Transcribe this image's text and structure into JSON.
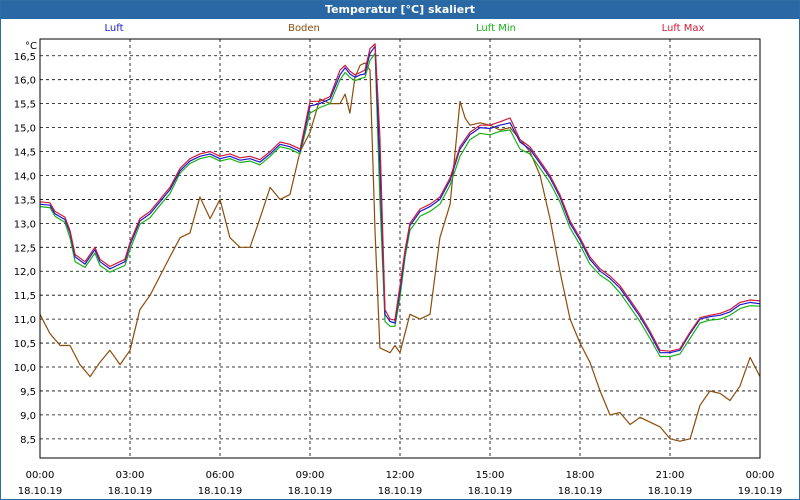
{
  "window": {
    "title": "Temperatur [°C] skaliert"
  },
  "chart_data": {
    "type": "line",
    "title": "Temperatur [°C] skaliert",
    "ylabel": "°C",
    "xlabel": "",
    "ylim": [
      8.1,
      16.85
    ],
    "xlim": [
      0,
      24
    ],
    "grid": true,
    "legend_placement": "top",
    "y_ticks": [
      "8,5",
      "9,0",
      "9,5",
      "10,0",
      "10,5",
      "11,0",
      "11,5",
      "12,0",
      "12,5",
      "13,0",
      "13,5",
      "14,0",
      "14,5",
      "15,0",
      "15,5",
      "16,0",
      "16,5"
    ],
    "x_ticks": [
      {
        "time": "00:00",
        "date": "18.10.19"
      },
      {
        "time": "03:00",
        "date": "18.10.19"
      },
      {
        "time": "06:00",
        "date": "18.10.19"
      },
      {
        "time": "09:00",
        "date": "18.10.19"
      },
      {
        "time": "12:00",
        "date": "18.10.19"
      },
      {
        "time": "15:00",
        "date": "18.10.19"
      },
      {
        "time": "18:00",
        "date": "18.10.19"
      },
      {
        "time": "21:00",
        "date": "18.10.19"
      },
      {
        "time": "00:00",
        "date": "19.10.19"
      }
    ],
    "series": [
      {
        "name": "Luft",
        "color": "#1a1ad0",
        "x": [
          0,
          0.33,
          0.5,
          0.83,
          1.0,
          1.17,
          1.5,
          1.83,
          2.0,
          2.33,
          2.5,
          2.83,
          3.0,
          3.33,
          3.67,
          4.0,
          4.33,
          4.67,
          5.0,
          5.33,
          5.67,
          6.0,
          6.33,
          6.67,
          7.0,
          7.33,
          7.67,
          8.0,
          8.33,
          8.67,
          9.0,
          9.33,
          9.67,
          10.0,
          10.17,
          10.33,
          10.5,
          10.67,
          10.83,
          11.0,
          11.17,
          11.33,
          11.5,
          11.67,
          11.83,
          12.0,
          12.17,
          12.33,
          12.67,
          13.0,
          13.33,
          13.67,
          14.0,
          14.33,
          14.67,
          15.0,
          15.33,
          15.67,
          16.0,
          16.33,
          16.67,
          17.0,
          17.33,
          17.67,
          18.0,
          18.33,
          18.67,
          19.0,
          19.33,
          19.67,
          20.0,
          20.33,
          20.67,
          21.0,
          21.33,
          21.67,
          22.0,
          22.33,
          22.67,
          23.0,
          23.33,
          23.67,
          24.0
        ],
        "values": [
          13.4,
          13.38,
          13.2,
          13.08,
          12.8,
          12.3,
          12.15,
          12.45,
          12.2,
          12.05,
          12.1,
          12.2,
          12.55,
          13.05,
          13.2,
          13.45,
          13.7,
          14.1,
          14.3,
          14.4,
          14.45,
          14.35,
          14.4,
          14.32,
          14.35,
          14.28,
          14.45,
          14.65,
          14.6,
          14.5,
          15.45,
          15.5,
          15.6,
          16.1,
          16.25,
          16.12,
          16.05,
          16.1,
          16.12,
          16.55,
          16.7,
          14.2,
          11.1,
          10.95,
          10.92,
          11.6,
          12.4,
          12.95,
          13.25,
          13.35,
          13.5,
          13.9,
          14.55,
          14.85,
          15.0,
          14.98,
          15.05,
          15.1,
          14.7,
          14.55,
          14.25,
          13.95,
          13.55,
          13.0,
          12.65,
          12.25,
          12.0,
          11.85,
          11.65,
          11.35,
          11.05,
          10.7,
          10.3,
          10.3,
          10.35,
          10.7,
          11.0,
          11.05,
          11.08,
          11.15,
          11.3,
          11.35,
          11.32
        ]
      },
      {
        "name": "Boden",
        "color": "#8b4d0c",
        "x": [
          0,
          0.33,
          0.67,
          1.0,
          1.33,
          1.67,
          2.0,
          2.33,
          2.67,
          3.0,
          3.33,
          3.67,
          4.0,
          4.33,
          4.67,
          5.0,
          5.33,
          5.67,
          6.0,
          6.33,
          6.67,
          7.0,
          7.33,
          7.67,
          8.0,
          8.33,
          8.67,
          9.0,
          9.33,
          9.67,
          10.0,
          10.17,
          10.33,
          10.5,
          10.67,
          10.83,
          11.0,
          11.17,
          11.33,
          11.5,
          11.67,
          11.83,
          12.0,
          12.33,
          12.67,
          13.0,
          13.33,
          13.67,
          14.0,
          14.17,
          14.33,
          14.67,
          15.0,
          15.33,
          15.67,
          16.0,
          16.33,
          16.67,
          17.0,
          17.33,
          17.67,
          18.0,
          18.33,
          18.67,
          19.0,
          19.33,
          19.67,
          20.0,
          20.33,
          20.67,
          21.0,
          21.33,
          21.67,
          22.0,
          22.33,
          22.67,
          23.0,
          23.33,
          23.67,
          24.0
        ],
        "values": [
          11.1,
          10.7,
          10.45,
          10.45,
          10.05,
          9.8,
          10.1,
          10.35,
          10.05,
          10.35,
          11.2,
          11.5,
          11.9,
          12.3,
          12.7,
          12.8,
          13.55,
          13.1,
          13.5,
          12.7,
          12.5,
          12.5,
          13.1,
          13.75,
          13.5,
          13.6,
          14.5,
          14.9,
          15.6,
          15.5,
          15.5,
          15.7,
          15.3,
          16.05,
          16.3,
          16.35,
          16.2,
          12.8,
          10.4,
          10.35,
          10.3,
          10.45,
          10.3,
          11.1,
          11.0,
          11.1,
          12.7,
          13.4,
          15.55,
          15.2,
          15.05,
          15.1,
          15.05,
          14.95,
          15.0,
          14.75,
          14.5,
          14.0,
          13.1,
          12.0,
          11.0,
          10.5,
          10.1,
          9.5,
          9.0,
          9.05,
          8.8,
          8.95,
          8.85,
          8.75,
          8.5,
          8.45,
          8.5,
          9.2,
          9.5,
          9.45,
          9.3,
          9.6,
          10.2,
          9.8
        ]
      },
      {
        "name": "Luft Min",
        "color": "#18b018",
        "x": [
          0,
          0.33,
          0.5,
          0.83,
          1.0,
          1.17,
          1.5,
          1.83,
          2.0,
          2.33,
          2.5,
          2.83,
          3.0,
          3.33,
          3.67,
          4.0,
          4.33,
          4.67,
          5.0,
          5.33,
          5.67,
          6.0,
          6.33,
          6.67,
          7.0,
          7.33,
          7.67,
          8.0,
          8.33,
          8.67,
          9.0,
          9.33,
          9.67,
          10.0,
          10.17,
          10.33,
          10.5,
          10.67,
          10.83,
          11.0,
          11.17,
          11.33,
          11.5,
          11.67,
          11.83,
          12.0,
          12.17,
          12.33,
          12.67,
          13.0,
          13.33,
          13.67,
          14.0,
          14.33,
          14.67,
          15.0,
          15.33,
          15.67,
          16.0,
          16.33,
          16.67,
          17.0,
          17.33,
          17.67,
          18.0,
          18.33,
          18.67,
          19.0,
          19.33,
          19.67,
          20.0,
          20.33,
          20.67,
          21.0,
          21.33,
          21.67,
          22.0,
          22.33,
          22.67,
          23.0,
          23.33,
          23.67,
          24.0
        ],
        "values": [
          13.35,
          13.33,
          13.15,
          13.02,
          12.7,
          12.2,
          12.08,
          12.38,
          12.12,
          11.98,
          12.03,
          12.12,
          12.45,
          12.98,
          13.12,
          13.38,
          13.62,
          14.05,
          14.25,
          14.35,
          14.4,
          14.3,
          14.35,
          14.27,
          14.3,
          14.22,
          14.4,
          14.6,
          14.55,
          14.45,
          15.3,
          15.42,
          15.5,
          16.0,
          16.15,
          16.05,
          15.98,
          16.02,
          16.05,
          16.4,
          16.55,
          13.5,
          10.95,
          10.85,
          10.85,
          11.45,
          12.3,
          12.85,
          13.15,
          13.25,
          13.4,
          13.8,
          14.4,
          14.75,
          14.88,
          14.85,
          14.92,
          14.95,
          14.55,
          14.45,
          14.15,
          13.85,
          13.45,
          12.9,
          12.55,
          12.15,
          11.92,
          11.78,
          11.55,
          11.25,
          10.95,
          10.6,
          10.22,
          10.22,
          10.27,
          10.6,
          10.92,
          10.98,
          11.0,
          11.08,
          11.22,
          11.28,
          11.27
        ]
      },
      {
        "name": "Luft Max",
        "color": "#d01a3a",
        "x": [
          0,
          0.33,
          0.5,
          0.83,
          1.0,
          1.17,
          1.5,
          1.83,
          2.0,
          2.33,
          2.5,
          2.83,
          3.0,
          3.33,
          3.67,
          4.0,
          4.33,
          4.67,
          5.0,
          5.33,
          5.67,
          6.0,
          6.33,
          6.67,
          7.0,
          7.33,
          7.67,
          8.0,
          8.33,
          8.67,
          9.0,
          9.33,
          9.67,
          10.0,
          10.17,
          10.33,
          10.5,
          10.67,
          10.83,
          11.0,
          11.17,
          11.33,
          11.5,
          11.67,
          11.83,
          12.0,
          12.17,
          12.33,
          12.67,
          13.0,
          13.33,
          13.67,
          14.0,
          14.33,
          14.67,
          15.0,
          15.33,
          15.67,
          16.0,
          16.33,
          16.67,
          17.0,
          17.33,
          17.67,
          18.0,
          18.33,
          18.67,
          19.0,
          19.33,
          19.67,
          20.0,
          20.33,
          20.67,
          21.0,
          21.33,
          21.67,
          22.0,
          22.33,
          22.67,
          23.0,
          23.33,
          23.67,
          24.0
        ],
        "values": [
          13.45,
          13.43,
          13.25,
          13.13,
          12.85,
          12.35,
          12.2,
          12.5,
          12.25,
          12.1,
          12.15,
          12.25,
          12.6,
          13.1,
          13.25,
          13.5,
          13.75,
          14.15,
          14.35,
          14.45,
          14.5,
          14.4,
          14.45,
          14.37,
          14.4,
          14.33,
          14.5,
          14.7,
          14.65,
          14.55,
          15.55,
          15.55,
          15.65,
          16.2,
          16.3,
          16.18,
          16.1,
          16.15,
          16.2,
          16.65,
          16.75,
          14.8,
          11.2,
          11.0,
          10.98,
          11.7,
          12.45,
          13.0,
          13.3,
          13.4,
          13.55,
          13.95,
          14.6,
          14.9,
          15.05,
          15.05,
          15.12,
          15.2,
          14.75,
          14.6,
          14.3,
          14.0,
          13.6,
          13.05,
          12.7,
          12.3,
          12.05,
          11.9,
          11.7,
          11.4,
          11.1,
          10.75,
          10.35,
          10.33,
          10.38,
          10.73,
          11.03,
          11.08,
          11.12,
          11.2,
          11.35,
          11.4,
          11.38
        ]
      }
    ]
  }
}
